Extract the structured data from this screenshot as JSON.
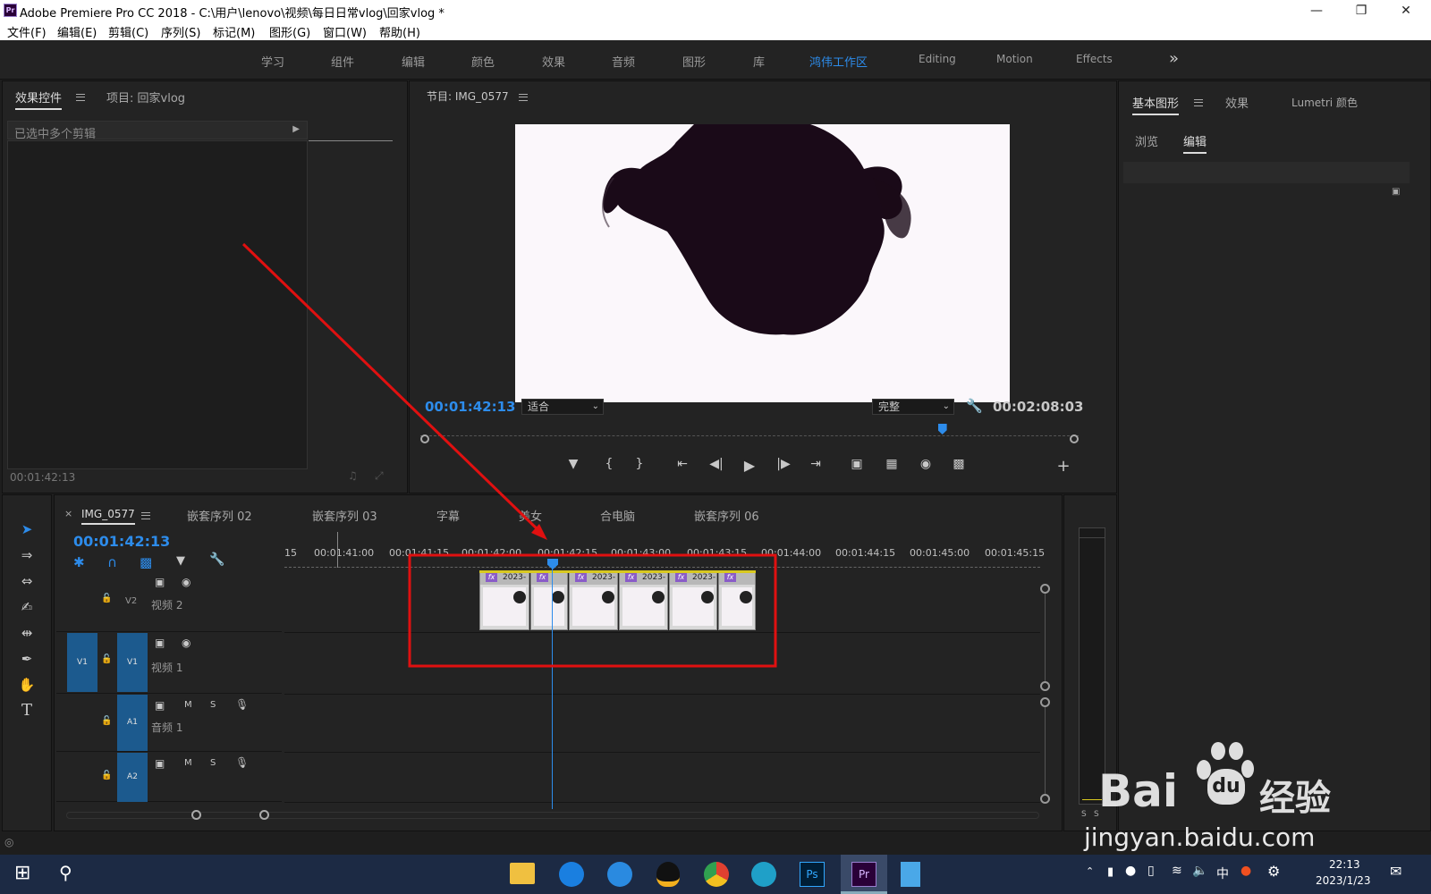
{
  "window": {
    "title": "Adobe Premiere Pro CC 2018 - C:\\用户\\lenovo\\视频\\每日日常vlog\\回家vlog *",
    "app_icon": "Pr"
  },
  "menu": [
    "文件(F)",
    "编辑(E)",
    "剪辑(C)",
    "序列(S)",
    "标记(M)",
    "图形(G)",
    "窗口(W)",
    "帮助(H)"
  ],
  "workspaces": [
    "学习",
    "组件",
    "编辑",
    "颜色",
    "效果",
    "音频",
    "图形",
    "库",
    "鸿伟工作区",
    "Editing",
    "Motion",
    "Effects"
  ],
  "active_workspace": "鸿伟工作区",
  "effect_panel": {
    "tab1": "效果控件",
    "tab2": "项目: 回家vlog",
    "multi_clip": "已选中多个剪辑",
    "timecode": "00:01:42:13"
  },
  "program": {
    "title": "节目: IMG_0577",
    "timecode": "00:01:42:13",
    "fit": "适合",
    "quality": "完整",
    "duration": "00:02:08:03",
    "playhead_fraction": 0.793
  },
  "right_panel": {
    "tab1": "基本图形",
    "tab2": "效果",
    "tab3": "Lumetri 颜色",
    "sub1": "浏览",
    "sub2": "编辑"
  },
  "timeline": {
    "tabs": [
      "IMG_0577",
      "嵌套序列 02",
      "嵌套序列 03",
      "字幕",
      "美女",
      "合电脑",
      "嵌套序列 06"
    ],
    "close": "×",
    "timecode": "00:01:42:13",
    "ruler": [
      "15",
      "00:01:41:00",
      "00:01:41:15",
      "00:01:42:00",
      "00:01:42:15",
      "00:01:43:00",
      "00:01:43:15",
      "00:01:44:00",
      "00:01:44:15",
      "00:01:45:00",
      "00:01:45:15"
    ],
    "tracks": {
      "v2": "V2",
      "v2_name": "视频 2",
      "v1": "V1",
      "v1_name": "视频 1",
      "a1": "A1",
      "a1_name": "音频 1",
      "a2": "A2",
      "m": "M",
      "s": "S"
    },
    "clip_label": "2023-",
    "fx": "fx"
  },
  "meter": {
    "s1": "S",
    "s2": "S"
  },
  "taskbar": {
    "ime": "中",
    "time": "22:13",
    "date": "2023/1/23"
  },
  "watermark": {
    "brand": "Bai",
    "brand2": "经验",
    "url": "jingyan.baidu.com"
  },
  "colors": {
    "accent": "#2d8ceb",
    "annotation": "#e01010"
  }
}
